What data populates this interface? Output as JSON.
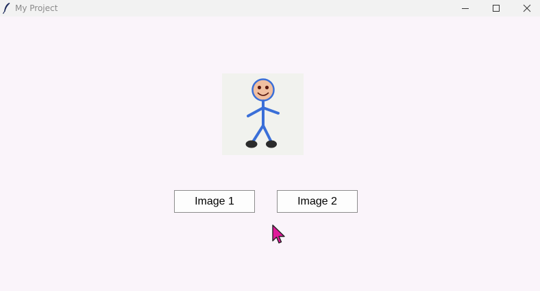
{
  "window": {
    "title": "My Project",
    "app_icon": "feather-icon",
    "controls": [
      "minimize-icon",
      "maximize-icon",
      "close-icon"
    ]
  },
  "content": {
    "image": {
      "icon": "stick-figure-icon",
      "colors": {
        "background": "#f1f2ee",
        "body": "#3a6fd8",
        "face": "#f1bfa0",
        "feet": "#2b2b2b"
      }
    },
    "buttons": {
      "image1_label": "Image 1",
      "image2_label": "Image 2"
    }
  },
  "cursor": {
    "icon": "mouse-pointer-icon",
    "color": "#e0189a"
  }
}
